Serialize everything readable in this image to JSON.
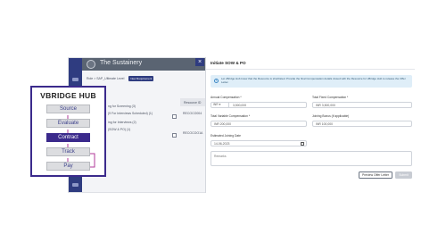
{
  "app": {
    "title": "The Sustainery",
    "breadcrumb": [
      "Role",
      ">",
      "SAP_Ultimate Level"
    ],
    "breadcrumb_badge": "New Requirement",
    "column_header": "Resource ID",
    "rows": [
      {
        "text": "ng for Screening (3)",
        "resource_id": ""
      },
      {
        "text": "(9 For Interviews Scheduled) (1)",
        "resource_id": "RECOCO004"
      },
      {
        "text": "ing for Interviews (2)",
        "resource_id": ""
      },
      {
        "text": "(SOW & PO) (1)",
        "resource_id": "RECOCOO1A"
      }
    ]
  },
  "modal": {
    "title": "Initiate SOW & PO",
    "close_glyph": "×",
    "info_text": "Let vBridge Hub know that the Resource is shortlisted. Provide the final Compensation details closed with the Resource for vBridge Hub to release the Offer Letter.",
    "fields": {
      "annual_comp": {
        "label": "Annual Compensation *",
        "currency": "INR",
        "value": "3,500,000"
      },
      "total_fixed": {
        "label": "Total Fixed Compensation *",
        "value": "INR 3,500,000"
      },
      "total_variable": {
        "label": "Total Variable Compensation *",
        "value": "INR 200,000"
      },
      "joining_bonus": {
        "label": "Joining Bonus (if applicable)",
        "value": "INR 100,000"
      },
      "joining_date": {
        "label": "Estimated Joining Date",
        "value": "14-06-2023"
      },
      "remarks": {
        "placeholder": "Remarks"
      }
    },
    "buttons": {
      "preview": "Preview Offer Letter",
      "submit": "Submit"
    }
  },
  "hub": {
    "title": "VBRIDGE HUB",
    "stages": [
      "Source",
      "Evaluate",
      "Contract",
      "Track",
      "Pay"
    ],
    "active_stage": "Contract"
  },
  "colors": {
    "brand_purple": "#3b2a8c",
    "rail_navy": "#2f3c80",
    "info_bg": "#dfeef8"
  }
}
